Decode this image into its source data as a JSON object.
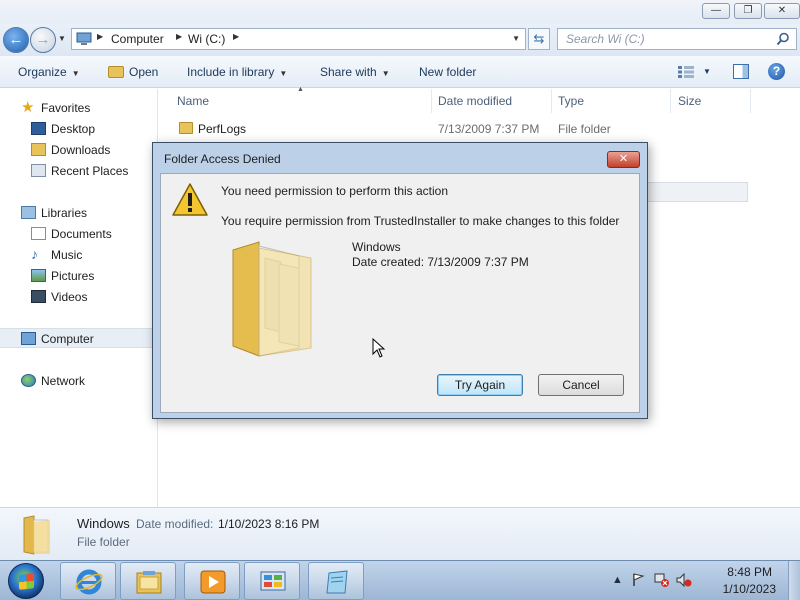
{
  "window": {
    "caption_minimize": "—",
    "caption_maximize": "❐",
    "caption_close": "✕"
  },
  "address": {
    "crumbs": [
      "Computer",
      "Wi (C:)"
    ],
    "search_placeholder": "Search Wi (C:)"
  },
  "toolbar": {
    "organize": "Organize",
    "open": "Open",
    "include_in_library": "Include in library",
    "share_with": "Share with",
    "new_folder": "New folder"
  },
  "nav": {
    "favorites": "Favorites",
    "desktop": "Desktop",
    "downloads": "Downloads",
    "recent_places": "Recent Places",
    "libraries": "Libraries",
    "documents": "Documents",
    "music": "Music",
    "pictures": "Pictures",
    "videos": "Videos",
    "computer": "Computer",
    "network": "Network"
  },
  "list": {
    "columns": [
      "Name",
      "Date modified",
      "Type",
      "Size"
    ],
    "rows": [
      {
        "name": "PerfLogs",
        "date": "7/13/2009 7:37 PM",
        "type": "File folder"
      }
    ]
  },
  "details": {
    "name": "Windows",
    "date_label": "Date modified:",
    "date_value": "1/10/2023 8:16 PM",
    "type": "File folder"
  },
  "dialog": {
    "title": "Folder Access Denied",
    "main_text": "You need permission to perform this action",
    "sub_text": "You require permission from TrustedInstaller to make changes to this folder",
    "folder_name": "Windows",
    "folder_date": "Date created: 7/13/2009 7:37 PM",
    "try_again": "Try Again",
    "cancel": "Cancel"
  },
  "taskbar": {
    "time": "8:48 PM",
    "date": "1/10/2023",
    "apps": [
      "internet-explorer",
      "windows-explorer",
      "media-player",
      "control-panel",
      "notepad"
    ]
  }
}
